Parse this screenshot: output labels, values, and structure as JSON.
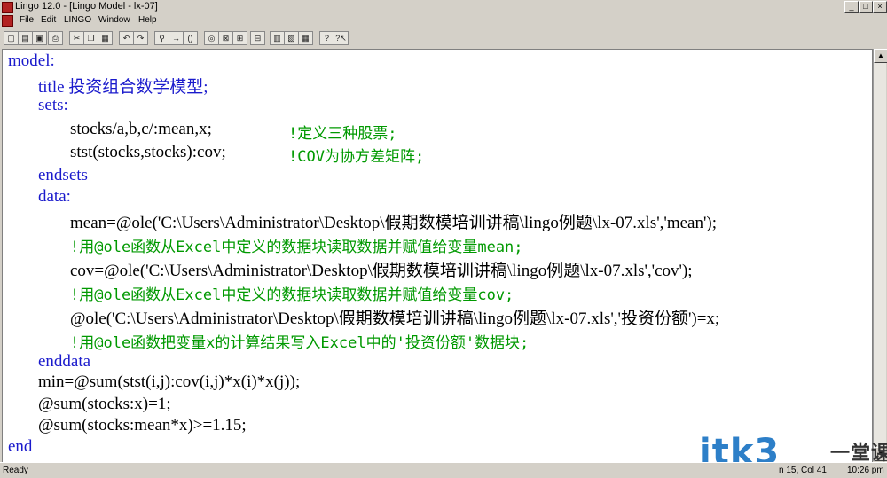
{
  "window": {
    "title": "Lingo 12.0 - [Lingo Model - lx-07]"
  },
  "menu": [
    "File",
    "Edit",
    "LINGO",
    "Window",
    "Help"
  ],
  "toolbar": [
    "new",
    "open",
    "save",
    "print",
    "cut",
    "copy",
    "paste",
    "undo",
    "redo",
    "find",
    "go-to-line",
    "match-paren",
    "solve",
    "solution",
    "matrix",
    "options",
    "tile",
    "cascade",
    "arrange",
    "help",
    "context-help"
  ],
  "code": {
    "l1": "model:",
    "l2": "title 投资组合数学模型;",
    "l3": "sets:",
    "l4a": "stocks/a,b,c/:mean,x;",
    "l4b": "!定义三种股票;",
    "l5a": "stst(stocks,stocks):cov;",
    "l5b": "!COV为协方差矩阵;",
    "l6": "endsets",
    "l7": "data:",
    "l8": "mean=@ole('C:\\Users\\Administrator\\Desktop\\假期数模培训讲稿\\lingo例题\\lx-07.xls','mean');",
    "l9": "!用@ole函数从Excel中定义的数据块读取数据并赋值给变量mean;",
    "l10": "cov=@ole('C:\\Users\\Administrator\\Desktop\\假期数模培训讲稿\\lingo例题\\lx-07.xls','cov');",
    "l11": "!用@ole函数从Excel中定义的数据块读取数据并赋值给变量cov;",
    "l12": "@ole('C:\\Users\\Administrator\\Desktop\\假期数模培训讲稿\\lingo例题\\lx-07.xls','投资份额')=x;",
    "l13": "!用@ole函数把变量x的计算结果写入Excel中的'投资份额'数据块;",
    "l14": "enddata",
    "l15": "min=@sum(stst(i,j):cov(i,j)*x(i)*x(j));",
    "l16": "@sum(stocks:x)=1;",
    "l17": "@sum(stocks:mean*x)>=1.15;",
    "l18": "end"
  },
  "status": {
    "ready": "Ready",
    "pos": "n 15, Col 41",
    "time": "10:26 pm"
  },
  "watermark": {
    "brand": "itk3",
    "cn": "一堂课"
  }
}
